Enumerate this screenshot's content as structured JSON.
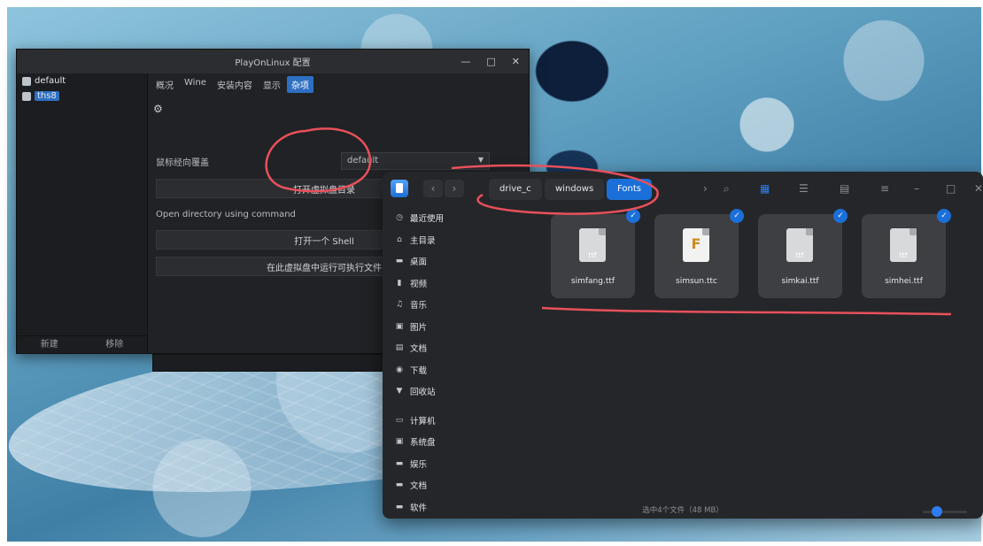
{
  "playonlinux": {
    "title": "PlayOnLinux 配置",
    "controls": [
      "—",
      "□",
      "✕"
    ],
    "sidebar": {
      "items": [
        {
          "label": "default",
          "selected": false
        },
        {
          "label": "ths8",
          "selected": true
        }
      ],
      "new_label": "新建",
      "remove_label": "移除"
    },
    "tabs": [
      "概况",
      "Wine",
      "安装内容",
      "显示",
      "杂项"
    ],
    "active_tab": "杂项",
    "mouse_warp_label": "鼠标经向覆盖",
    "mouse_warp_value": "default",
    "open_drive_button": "打开虚拟盘目录",
    "open_dir_label": "Open directory using command",
    "open_shell_button": "打开一个 Shell",
    "run_exe_button": "在此虚拟盘中运行可执行文件"
  },
  "file_manager": {
    "breadcrumbs": [
      "drive_c",
      "windows",
      "Fonts"
    ],
    "active_crumb": "Fonts",
    "sidebar": {
      "places": [
        {
          "icon": "clock-icon",
          "label": "最近使用"
        },
        {
          "icon": "home-icon",
          "label": "主目录"
        },
        {
          "icon": "desktop-icon",
          "label": "桌面"
        },
        {
          "icon": "video-icon",
          "label": "视频"
        },
        {
          "icon": "music-icon",
          "label": "音乐"
        },
        {
          "icon": "image-icon",
          "label": "图片"
        },
        {
          "icon": "document-icon",
          "label": "文档"
        },
        {
          "icon": "download-icon",
          "label": "下载"
        },
        {
          "icon": "trash-icon",
          "label": "回收站"
        }
      ],
      "devices": [
        {
          "icon": "computer-icon",
          "label": "计算机"
        },
        {
          "icon": "disk-icon",
          "label": "系统盘"
        },
        {
          "icon": "disk-icon",
          "label": "娱乐"
        },
        {
          "icon": "disk-icon",
          "label": "文档"
        },
        {
          "icon": "disk-icon",
          "label": "软件"
        }
      ]
    },
    "files": [
      {
        "name": "simfang.ttf",
        "ext": "ttf",
        "selected": true
      },
      {
        "name": "simsun.ttc",
        "ext": "F",
        "selected": true
      },
      {
        "name": "simkai.ttf",
        "ext": "ttf",
        "selected": true
      },
      {
        "name": "simhei.ttf",
        "ext": "ttf",
        "selected": true
      }
    ],
    "status": "选中4个文件（48 MB）"
  },
  "colors": {
    "accent": "#1b6fd8",
    "annotation": "#e8505b"
  }
}
